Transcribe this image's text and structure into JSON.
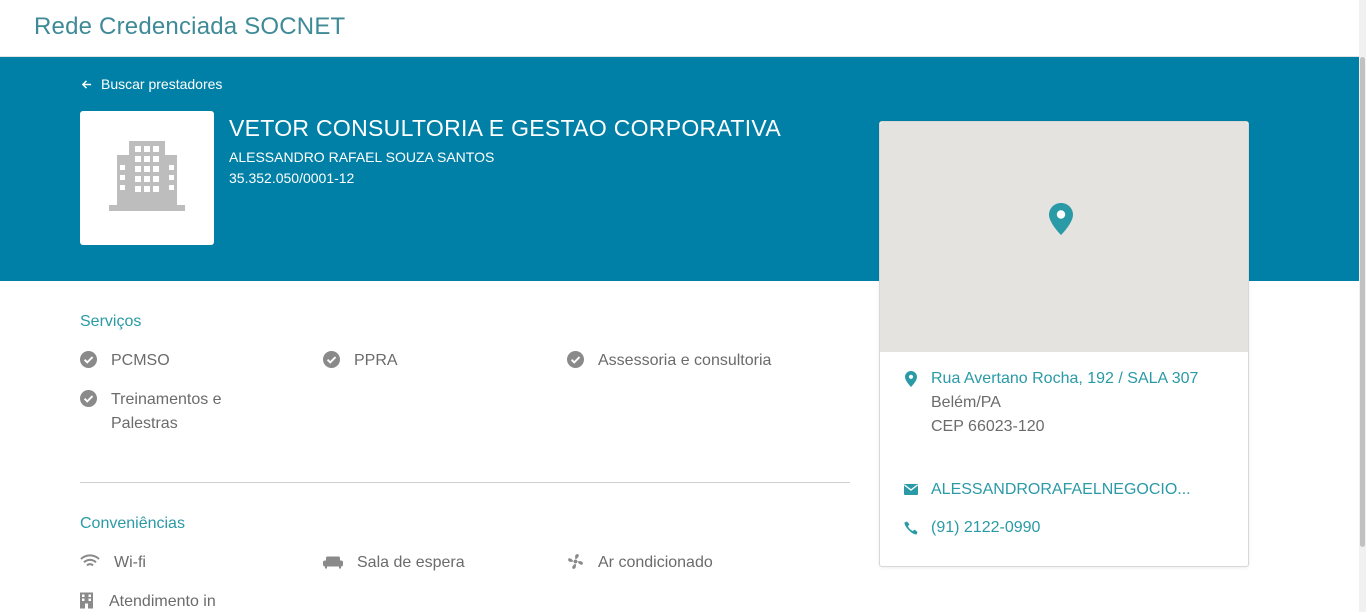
{
  "header": {
    "title": "Rede Credenciada SOCNET"
  },
  "hero": {
    "back_label": "Buscar prestadores",
    "name": "VETOR CONSULTORIA E GESTAO CORPORATIVA",
    "owner": "ALESSANDRO RAFAEL SOUZA SANTOS",
    "cnpj": "35.352.050/0001-12"
  },
  "services": {
    "title": "Serviços",
    "items": [
      {
        "label": "PCMSO",
        "icon": "check-circle-icon"
      },
      {
        "label": "PPRA",
        "icon": "check-circle-icon"
      },
      {
        "label": "Assessoria e consultoria",
        "icon": "check-circle-icon"
      },
      {
        "label": "Treinamentos e Palestras",
        "icon": "check-circle-icon"
      }
    ]
  },
  "amenities": {
    "title": "Conveniências",
    "items": [
      {
        "label": "Wi-fi",
        "icon": "wifi-icon"
      },
      {
        "label": "Sala de espera",
        "icon": "sofa-icon"
      },
      {
        "label": "Ar condicionado",
        "icon": "fan-icon"
      },
      {
        "label": "Atendimento in",
        "icon": "building-icon"
      }
    ]
  },
  "contact": {
    "address_line1": "Rua Avertano Rocha, 192 / SALA 307",
    "city": "Belém/PA",
    "cep": "CEP 66023-120",
    "email": "ALESSANDRORAFAELNEGOCIO...",
    "phone": "(91) 2122-0990"
  },
  "colors": {
    "brand": "#0080a6",
    "accent": "#2a9aa6",
    "title": "#3e8a96"
  }
}
